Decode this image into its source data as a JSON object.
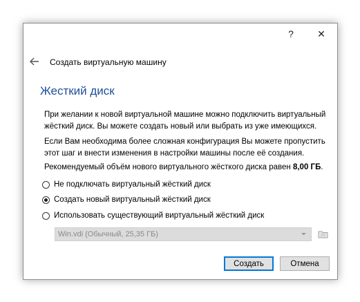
{
  "titlebar": {
    "help_label": "?",
    "close_label": "✕"
  },
  "header": {
    "title": "Создать виртуальную машину"
  },
  "section_title": "Жесткий диск",
  "paragraphs": {
    "p1": "При желании к новой виртуальной машине можно подключить виртуальный жёсткий диск. Вы можете создать новый или выбрать из уже имеющихся.",
    "p2": "Если Вам необходима более сложная конфигурация Вы можете пропустить этот шаг и внести изменения в настройки машины после её создания.",
    "p3_prefix": "Рекомендуемый объём нового виртуального жёсткого диска равен ",
    "p3_size": "8,00 ГБ",
    "p3_suffix": "."
  },
  "radio_options": [
    {
      "label": "Не подключать виртуальный жёсткий диск",
      "checked": false
    },
    {
      "label": "Создать новый виртуальный жёсткий диск",
      "checked": true
    },
    {
      "label": "Использовать существующий виртуальный жёсткий диск",
      "checked": false
    }
  ],
  "existing_disk": {
    "selected": "Win.vdi (Обычный, 25,35 ГБ)",
    "enabled": false
  },
  "buttons": {
    "create": "Создать",
    "cancel": "Отмена"
  },
  "colors": {
    "title_blue": "#1f4e9b",
    "focus_blue": "#0078d7"
  },
  "icons": {
    "back": "arrow-left-icon",
    "close": "close-icon",
    "folder": "folder-icon",
    "dropdown": "chevron-down-icon"
  }
}
